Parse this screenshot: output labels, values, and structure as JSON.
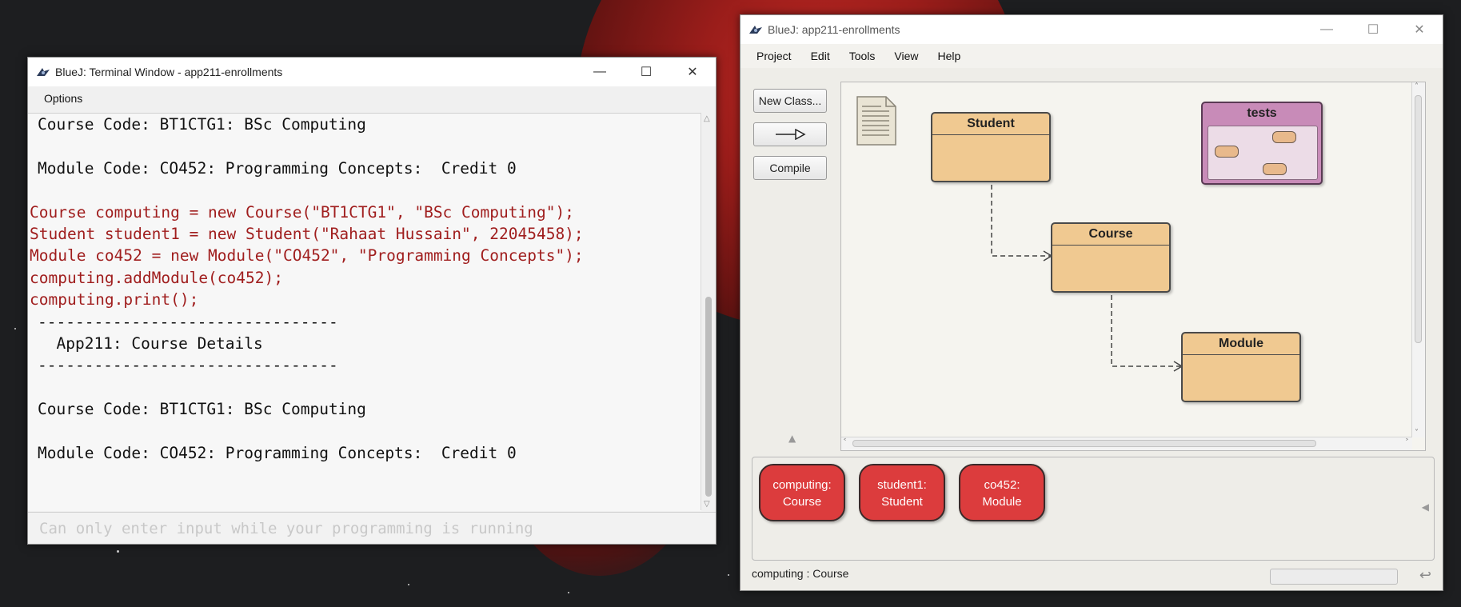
{
  "terminal": {
    "title": "BlueJ: Terminal Window - app211-enrollments",
    "menu": [
      "Options"
    ],
    "lines": [
      {
        "text": "Course Code: BT1CTG1: BSc Computing",
        "kind": "out"
      },
      {
        "text": "",
        "kind": "blank"
      },
      {
        "text": "Module Code: CO452: Programming Concepts:  Credit 0",
        "kind": "out"
      },
      {
        "text": "",
        "kind": "blank"
      },
      {
        "text": "Course computing = new Course(\"BT1CTG1\", \"BSc Computing\");",
        "kind": "code"
      },
      {
        "text": "Student student1 = new Student(\"Rahaat Hussain\", 22045458);",
        "kind": "code"
      },
      {
        "text": "Module co452 = new Module(\"CO452\", \"Programming Concepts\");",
        "kind": "code"
      },
      {
        "text": "computing.addModule(co452);",
        "kind": "code"
      },
      {
        "text": "computing.print();",
        "kind": "code"
      },
      {
        "text": "--------------------------------",
        "kind": "out"
      },
      {
        "text": "  App211: Course Details",
        "kind": "out"
      },
      {
        "text": "--------------------------------",
        "kind": "out"
      },
      {
        "text": "",
        "kind": "blank"
      },
      {
        "text": "Course Code: BT1CTG1: BSc Computing",
        "kind": "out"
      },
      {
        "text": "",
        "kind": "blank"
      },
      {
        "text": "Module Code: CO452: Programming Concepts:  Credit 0",
        "kind": "out"
      }
    ],
    "input_placeholder": "Can only enter input while your programming is running"
  },
  "bluej": {
    "title": "BlueJ:  app211-enrollments",
    "menu": [
      "Project",
      "Edit",
      "Tools",
      "View",
      "Help"
    ],
    "buttons": {
      "new_class": "New Class...",
      "compile": "Compile"
    },
    "classes": {
      "student": "Student",
      "course": "Course",
      "module": "Module",
      "tests": "tests"
    },
    "objects": [
      {
        "line1": "computing:",
        "line2": "Course"
      },
      {
        "line1": "student1:",
        "line2": "Student"
      },
      {
        "line1": "co452:",
        "line2": "Module"
      }
    ],
    "status": "computing : Course"
  },
  "colors": {
    "class_fill": "#f0c991",
    "package_fill": "#c88bb8",
    "object_fill": "#dc3c3d",
    "code_text": "#a01e1e"
  }
}
